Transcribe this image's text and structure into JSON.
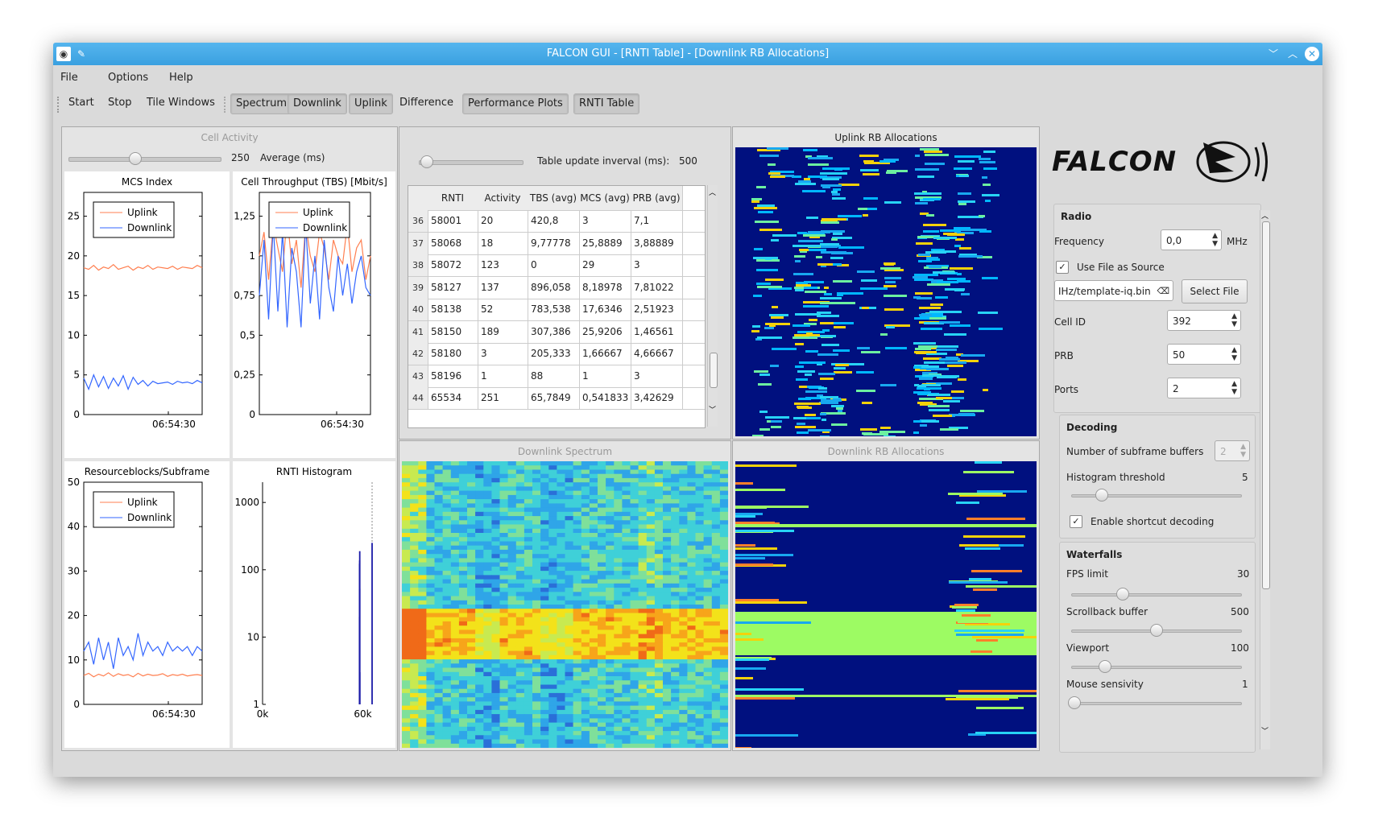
{
  "window": {
    "title": "FALCON GUI - [RNTI Table] - [Downlink RB Allocations]"
  },
  "menu": [
    "File",
    "Options",
    "Help"
  ],
  "toolbar": {
    "start": "Start",
    "stop": "Stop",
    "tile": "Tile Windows",
    "spectrum": "Spectrum",
    "downlink": "Downlink",
    "uplink": "Uplink",
    "difference": "Difference",
    "perf": "Performance Plots",
    "rnti": "RNTI Table"
  },
  "cell_activity": {
    "title": "Cell Activity",
    "avg_value": "250",
    "avg_label": "Average (ms)",
    "mcs": {
      "title": "MCS Index",
      "time": "06:54:30",
      "yticks": [
        "25",
        "20",
        "15",
        "10",
        "5",
        "0"
      ]
    },
    "tbs": {
      "title": "Cell Throughput (TBS) [Mbit/s]",
      "time": "06:54:30",
      "yticks": [
        "1,25",
        "1",
        "0,75",
        "0,5",
        "0,25",
        "0"
      ]
    },
    "rb": {
      "title": "Resourceblocks/Subframe",
      "time": "06:54:30",
      "yticks": [
        "50",
        "40",
        "30",
        "20",
        "10",
        "0"
      ]
    },
    "hist": {
      "title": "RNTI Histogram",
      "yticks": [
        "1000",
        "100",
        "10",
        "1"
      ],
      "xticks": [
        "0k",
        "60k"
      ]
    },
    "legend": {
      "uplink": "Uplink",
      "downlink": "Downlink"
    }
  },
  "rnti_table": {
    "interval_label": "Table update inverval (ms):",
    "interval_value": "500",
    "headers": [
      "RNTI",
      "Activity",
      "TBS (avg)",
      "MCS (avg)",
      "PRB (avg)"
    ],
    "rows": [
      {
        "n": "36",
        "rnti": "58001",
        "activity": "20",
        "tbs": "420,8",
        "mcs": "3",
        "prb": "7,1"
      },
      {
        "n": "37",
        "rnti": "58068",
        "activity": "18",
        "tbs": "9,77778",
        "mcs": "25,8889",
        "prb": "3,88889"
      },
      {
        "n": "38",
        "rnti": "58072",
        "activity": "123",
        "tbs": "0",
        "mcs": "29",
        "prb": "3"
      },
      {
        "n": "39",
        "rnti": "58127",
        "activity": "137",
        "tbs": "896,058",
        "mcs": "8,18978",
        "prb": "7,81022"
      },
      {
        "n": "40",
        "rnti": "58138",
        "activity": "52",
        "tbs": "783,538",
        "mcs": "17,6346",
        "prb": "2,51923"
      },
      {
        "n": "41",
        "rnti": "58150",
        "activity": "189",
        "tbs": "307,386",
        "mcs": "25,9206",
        "prb": "1,46561"
      },
      {
        "n": "42",
        "rnti": "58180",
        "activity": "3",
        "tbs": "205,333",
        "mcs": "1,66667",
        "prb": "4,66667"
      },
      {
        "n": "43",
        "rnti": "58196",
        "activity": "1",
        "tbs": "88",
        "mcs": "1",
        "prb": "3"
      },
      {
        "n": "44",
        "rnti": "65534",
        "activity": "251",
        "tbs": "65,7849",
        "mcs": "0,541833",
        "prb": "3,42629"
      }
    ]
  },
  "panels": {
    "uplink_rb": "Uplink RB Allocations",
    "downlink_spectrum": "Downlink Spectrum",
    "downlink_rb": "Downlink RB Allocations"
  },
  "logo": {
    "text": "FALCON"
  },
  "radio": {
    "title": "Radio",
    "frequency_label": "Frequency",
    "frequency_value": "0,0",
    "frequency_unit": "MHz",
    "use_file_label": "Use File as Source",
    "use_file_checked": true,
    "file_value": "IHz/template-iq.bin",
    "select_file": "Select File",
    "cell_id_label": "Cell ID",
    "cell_id_value": "392",
    "prb_label": "PRB",
    "prb_value": "50",
    "ports_label": "Ports",
    "ports_value": "2"
  },
  "decoding": {
    "title": "Decoding",
    "buffers_label": "Number of subframe buffers",
    "buffers_value": "2",
    "hist_label": "Histogram threshold",
    "hist_value": "5",
    "shortcut_label": "Enable shortcut decoding",
    "shortcut_checked": true
  },
  "waterfalls": {
    "title": "Waterfalls",
    "fps_label": "FPS limit",
    "fps_value": "30",
    "scroll_label": "Scrollback buffer",
    "scroll_value": "500",
    "viewport_label": "Viewport",
    "viewport_value": "100",
    "mouse_label": "Mouse sensivity",
    "mouse_value": "1"
  },
  "colors": {
    "uplink": "#ff7f50",
    "downlink": "#3366ff",
    "waterfall_bg": "#00107f",
    "titlebar": "#45aae6"
  },
  "chart_data": [
    {
      "type": "line",
      "title": "MCS Index",
      "xlabel": "",
      "ylabel": "",
      "ylim": [
        0,
        28
      ],
      "series": [
        {
          "name": "Uplink",
          "values": [
            18.5,
            18.3,
            18.8,
            18.2,
            18.6,
            18.4,
            18.9,
            18.3,
            18.5,
            18.7,
            18.2,
            18.6,
            18.4,
            18.8,
            18.3,
            18.6,
            18.5,
            18.4,
            18.7,
            18.3,
            18.6,
            18.5,
            18.4,
            18.8,
            18.5
          ]
        },
        {
          "name": "Downlink",
          "values": [
            4.6,
            3.2,
            5.0,
            3.5,
            4.8,
            3.3,
            4.6,
            3.6,
            4.9,
            3.2,
            4.7,
            3.8,
            4.3,
            3.6,
            4.2,
            3.9,
            4.0,
            4.1,
            3.8,
            4.2,
            4.0,
            4.1,
            3.9,
            4.3,
            4.0
          ]
        }
      ]
    },
    {
      "type": "line",
      "title": "Cell Throughput (TBS) [Mbit/s]",
      "xlabel": "",
      "ylabel": "",
      "ylim": [
        0,
        1.4
      ],
      "series": [
        {
          "name": "Uplink",
          "values": [
            1.0,
            1.15,
            0.85,
            1.2,
            1.05,
            0.9,
            1.25,
            0.95,
            1.1,
            0.8,
            1.2,
            1.0,
            0.9,
            1.15,
            1.05,
            0.85,
            1.1,
            1.0,
            0.95,
            1.2,
            0.9,
            1.05,
            1.1,
            0.85,
            1.0
          ]
        },
        {
          "name": "Downlink",
          "values": [
            0.75,
            1.1,
            0.6,
            1.2,
            0.65,
            1.15,
            0.55,
            1.05,
            0.9,
            0.55,
            1.2,
            0.7,
            1.0,
            0.6,
            1.1,
            0.8,
            0.65,
            1.0,
            0.75,
            0.95,
            0.7,
            0.9,
            1.0,
            0.8,
            0.75
          ]
        }
      ]
    },
    {
      "type": "line",
      "title": "Resourceblocks/Subframe",
      "xlabel": "",
      "ylabel": "",
      "ylim": [
        0,
        50
      ],
      "series": [
        {
          "name": "Uplink",
          "values": [
            6.5,
            7.0,
            6.2,
            6.8,
            6.4,
            7.1,
            6.3,
            6.9,
            6.5,
            6.7,
            6.2,
            7.0,
            6.4,
            6.8,
            6.5,
            6.6,
            6.9,
            6.3,
            6.7,
            6.5,
            6.8,
            6.4,
            6.6,
            6.7,
            6.5
          ]
        },
        {
          "name": "Downlink",
          "values": [
            12,
            14,
            9,
            15,
            10,
            14,
            8,
            15,
            11,
            13,
            10,
            16,
            11,
            14,
            12,
            13,
            11,
            14,
            12,
            13,
            12,
            13,
            11,
            13,
            12
          ]
        }
      ]
    },
    {
      "type": "bar",
      "title": "RNTI Histogram",
      "xlabel": "",
      "ylabel": "",
      "xlim": [
        0,
        65535
      ],
      "log_y": true,
      "ylim": [
        1,
        2000
      ],
      "series": [
        {
          "name": "",
          "x": [
            58001,
            58068,
            58072,
            58127,
            58138,
            58150,
            58180,
            58196,
            65534
          ],
          "values": [
            20,
            18,
            123,
            137,
            52,
            189,
            3,
            1,
            251
          ]
        }
      ]
    }
  ]
}
